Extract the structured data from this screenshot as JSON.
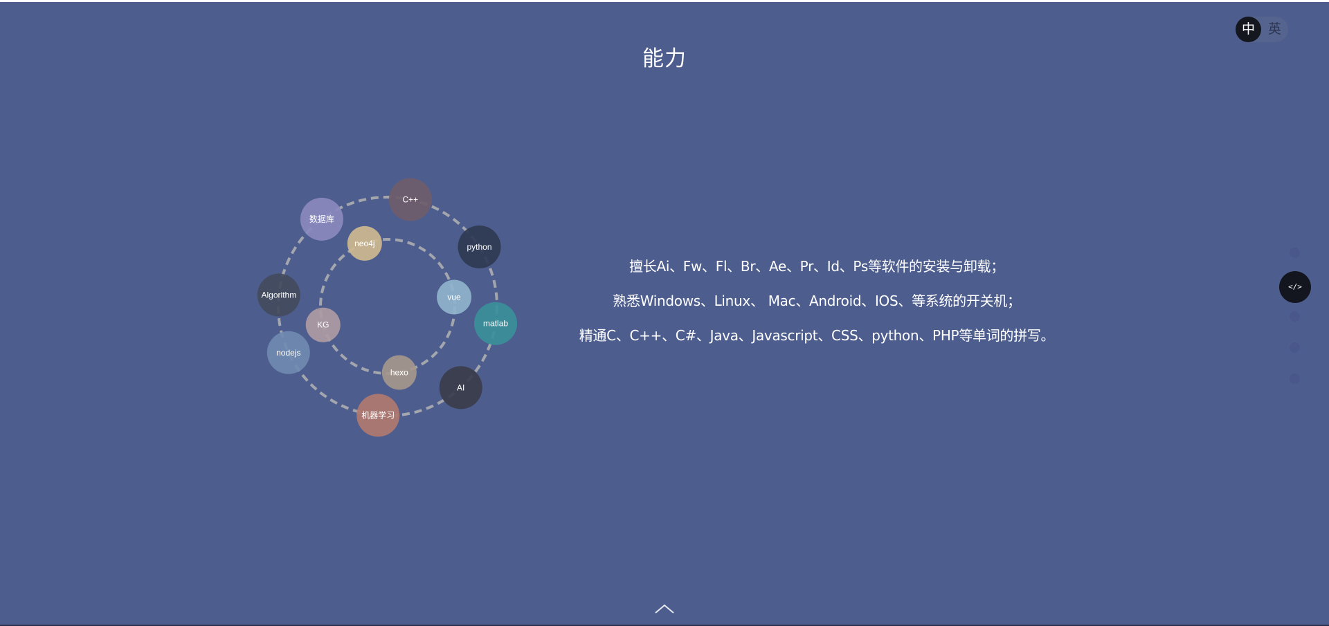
{
  "page": {
    "title": "能力",
    "background": "#4d5d8e"
  },
  "language_toggle": {
    "active": "中",
    "inactive": "英"
  },
  "skills": {
    "outer_ring": [
      {
        "label": "C++",
        "color": "#6e5d6b"
      },
      {
        "label": "python",
        "color": "#2f3a52"
      },
      {
        "label": "matlab",
        "color": "#3b8f9a"
      },
      {
        "label": "AI",
        "color": "#393d4b"
      },
      {
        "label": "机器学习",
        "color": "#b07a70"
      },
      {
        "label": "nodejs",
        "color": "#6f8ab0"
      },
      {
        "label": "Algorithm",
        "color": "#434b5d"
      },
      {
        "label": "数据库",
        "color": "#8a89be"
      }
    ],
    "inner_ring": [
      {
        "label": "neo4j",
        "color": "#cdb98f"
      },
      {
        "label": "vue",
        "color": "#8fb3cc"
      },
      {
        "label": "hexo",
        "color": "#a4978c"
      },
      {
        "label": "KG",
        "color": "#ad9ba3"
      }
    ]
  },
  "description": {
    "line1": "擅长Ai、Fw、Fl、Br、Ae、Pr、Id、Ps等软件的安装与卸载；",
    "line2": "熟悉Windows、Linux、 Mac、Android、IOS、等系统的开关机；",
    "line3": "精通C、C++、C#、Java、Javascript、CSS、python、PHP等单词的拼写。"
  },
  "side_nav": {
    "active_icon": "code-icon",
    "active_glyph": "</>"
  },
  "icons": {
    "scroll_up": "chevron-up-icon"
  }
}
